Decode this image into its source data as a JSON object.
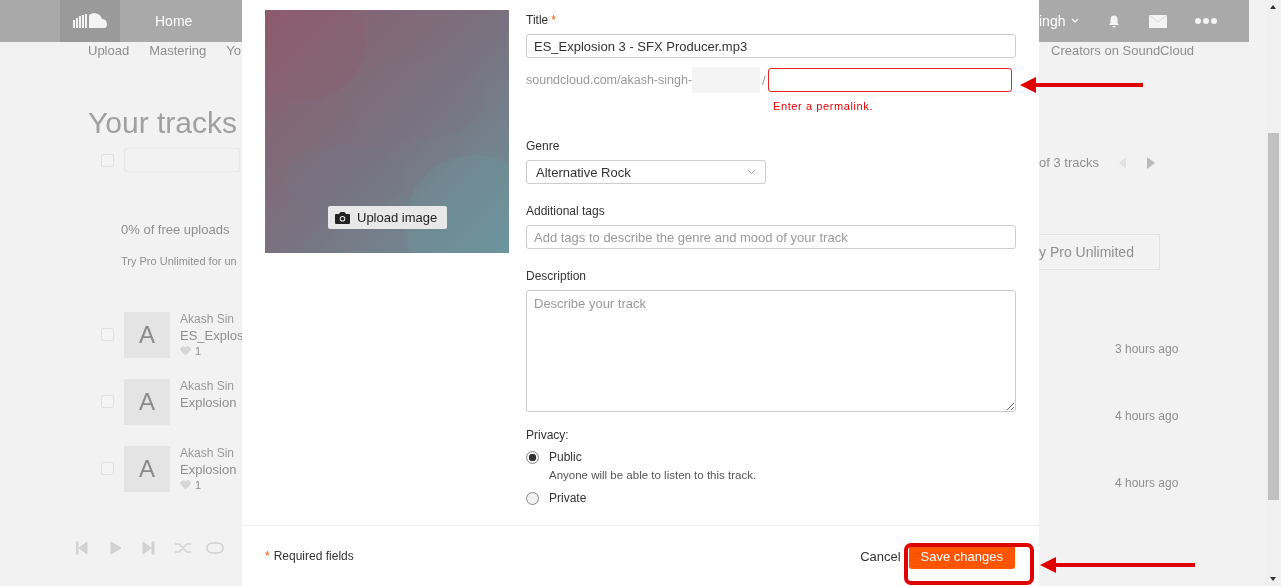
{
  "background": {
    "nav": {
      "home": "Home",
      "user": "ingh"
    },
    "subnav": [
      "Upload",
      "Mastering",
      "Yo"
    ],
    "creators_link": "Creators on SoundCloud",
    "heading": "Your tracks",
    "select_all": {
      "checked": false
    },
    "pager": "of 3 tracks",
    "quota": "0% of free uploads",
    "quota_note": "Try Pro Unlimited for un",
    "pro_button": "y Pro Unlimited",
    "tracks": [
      {
        "checked": false,
        "avatar": "A",
        "artist": "Akash Sin",
        "title": "ES_Explos",
        "likes": "1",
        "time": "3 hours ago"
      },
      {
        "checked": false,
        "avatar": "A",
        "artist": "Akash Sin",
        "title": "Explosion",
        "time": "4 hours ago"
      },
      {
        "checked": false,
        "avatar": "A",
        "artist": "Akash Sin",
        "title": "Explosion",
        "likes": "1",
        "time": "4 hours ago"
      }
    ]
  },
  "dialog": {
    "image_button": "Upload image",
    "title": {
      "label": "Title",
      "required_mark": "*",
      "value": "ES_Explosion 3 - SFX Producer.mp3"
    },
    "permalink": {
      "prefix": "soundcloud.com/akash-singh-",
      "separator": "/",
      "error": "Enter a permalink."
    },
    "genre": {
      "label": "Genre",
      "value": "Alternative Rock"
    },
    "tags": {
      "label": "Additional tags",
      "placeholder": "Add tags to describe the genre and mood of your track"
    },
    "description": {
      "label": "Description",
      "placeholder": "Describe your track"
    },
    "privacy": {
      "label": "Privacy:",
      "options": [
        {
          "label": "Public",
          "note": "Anyone will be able to listen to this track.",
          "selected": true
        },
        {
          "label": "Private",
          "selected": false
        }
      ]
    },
    "footer": {
      "required_mark": "*",
      "required_note": "Required fields",
      "cancel": "Cancel",
      "save": "Save changes"
    }
  },
  "annotations": [
    {
      "kind": "arrow"
    },
    {
      "kind": "frame"
    },
    {
      "kind": "arrow"
    }
  ]
}
